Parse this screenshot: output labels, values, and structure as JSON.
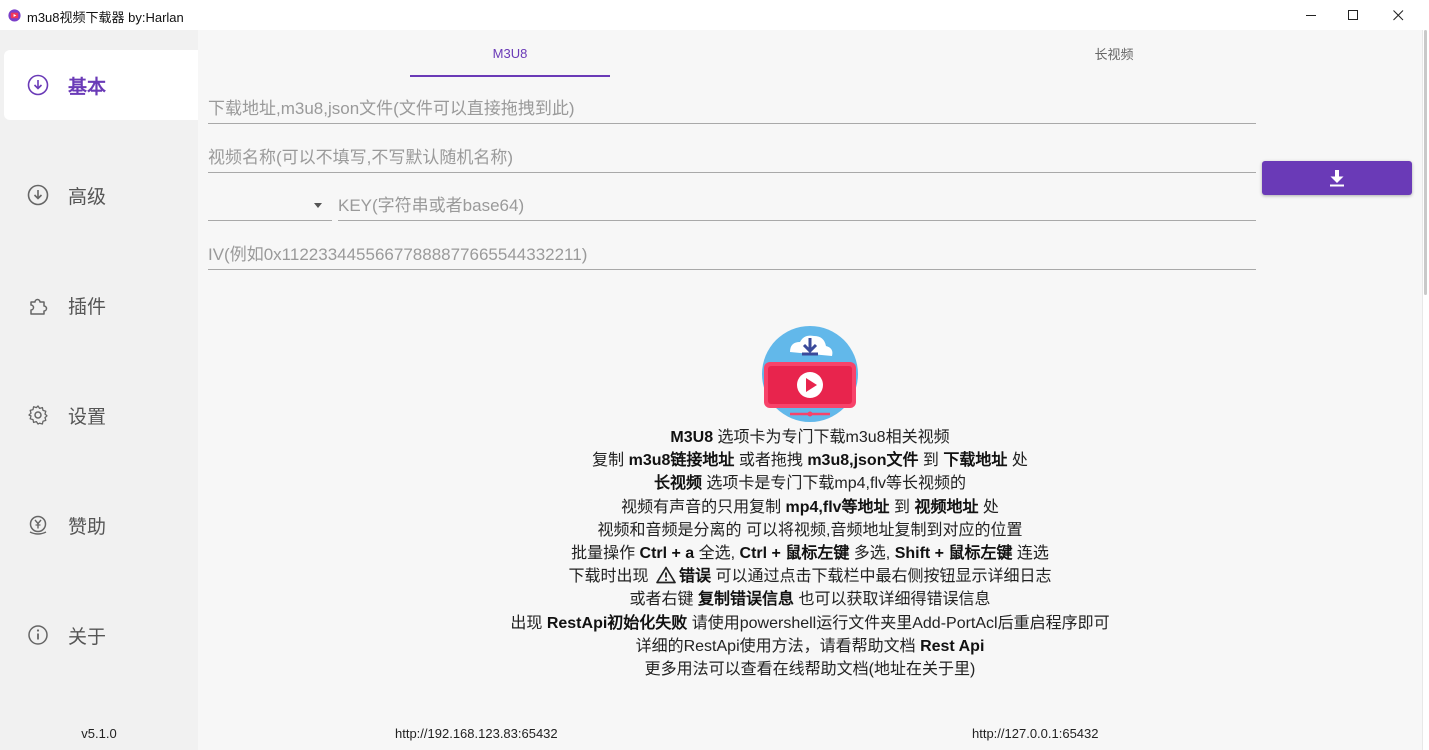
{
  "window": {
    "title": "m3u8视频下载器 by:Harlan",
    "minimize_glyph": "—",
    "maximize_glyph": "☐",
    "close_glyph": "✕"
  },
  "sidebar": {
    "items": [
      {
        "label": "基本",
        "icon": "download-circle-icon",
        "active": true
      },
      {
        "label": "高级",
        "icon": "download-circle-icon",
        "active": false
      },
      {
        "label": "插件",
        "icon": "puzzle-icon",
        "active": false
      },
      {
        "label": "设置",
        "icon": "gear-icon",
        "active": false
      },
      {
        "label": "赞助",
        "icon": "yen-coin-icon",
        "active": false
      },
      {
        "label": "关于",
        "icon": "info-icon",
        "active": false
      }
    ],
    "version": "v5.1.0"
  },
  "tabs": [
    {
      "label": "M3U8",
      "active": true
    },
    {
      "label": "长视频",
      "active": false
    }
  ],
  "form": {
    "url_placeholder": "下载地址,m3u8,json文件(文件可以直接拖拽到此)",
    "name_placeholder": "视频名称(可以不填写,不写默认随机名称)",
    "method_value": "",
    "key_placeholder": "KEY(字符串或者base64)",
    "iv_placeholder": "IV(例如0x11223344556677888877665544332211)"
  },
  "help": {
    "l1": {
      "a": "M3U8",
      "b": " 选项卡为专门下载m3u8相关视频"
    },
    "l2": {
      "a": "复制 ",
      "b": "m3u8链接地址",
      "c": " 或者拖拽 ",
      "d": "m3u8,json文件",
      "e": " 到 ",
      "f": "下载地址",
      "g": " 处"
    },
    "l3": {
      "a": "长视频",
      "b": " 选项卡是专门下载mp4,flv等长视频的"
    },
    "l4": {
      "a": "视频有声音的只用复制 ",
      "b": "mp4,flv等地址",
      "c": " 到 ",
      "d": "视频地址",
      "e": " 处"
    },
    "l5": {
      "a": "视频和音频是分离的 可以将视频,音频地址复制到对应的位置"
    },
    "l6": {
      "a": "批量操作 ",
      "b": "Ctrl + a",
      "c": " 全选, ",
      "d": "Ctrl + 鼠标左键",
      "e": " 多选, ",
      "f": "Shift + 鼠标左键",
      "g": " 连选"
    },
    "l7": {
      "a": "下载时出现 ",
      "b": "错误",
      "c": " 可以通过点击下载栏中最右侧按钮显示详细日志"
    },
    "l8": {
      "a": "或者右键 ",
      "b": "复制错误信息",
      "c": " 也可以获取详细得错误信息"
    },
    "l9": {
      "a": "出现 ",
      "b": "RestApi初始化失败",
      "c": " 请使用powershell运行文件夹里Add-PortAcl后重启程序即可"
    },
    "l10": {
      "a": "详细的RestApi使用方法，请看帮助文档 ",
      "b": "Rest Api"
    },
    "l11": {
      "a": "更多用法可以查看在线帮助文档(地址在关于里)"
    }
  },
  "footer": {
    "lan_url": "http://192.168.123.83:65432",
    "local_url": "http://127.0.0.1:65432"
  },
  "colors": {
    "accent": "#6a3ab7",
    "sidebar_bg": "#f1f1f1",
    "main_bg": "#f7f7f7"
  }
}
